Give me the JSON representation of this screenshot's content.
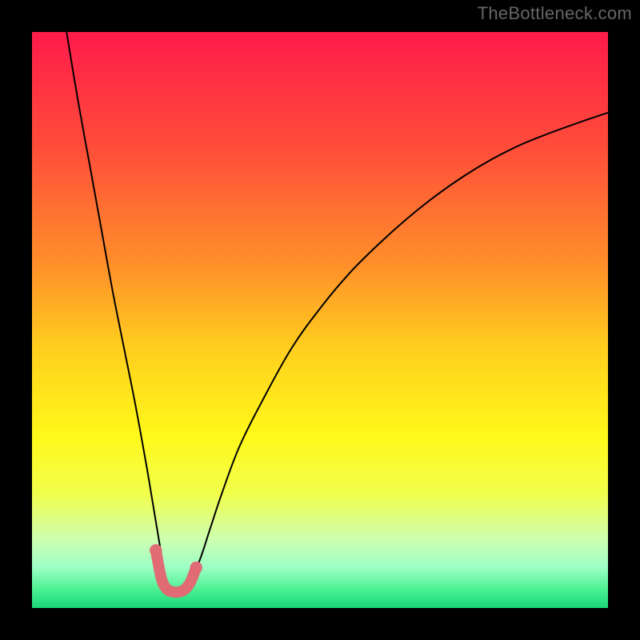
{
  "attribution": "TheBottleneck.com",
  "chart_data": {
    "type": "line",
    "title": "",
    "xlabel": "",
    "ylabel": "",
    "xlim": [
      0,
      100
    ],
    "ylim": [
      0,
      100
    ],
    "grid": false,
    "legend": false,
    "gradient_stops": [
      {
        "offset": 0.0,
        "color": "#ff1b4b"
      },
      {
        "offset": 0.2,
        "color": "#ff4d3a"
      },
      {
        "offset": 0.4,
        "color": "#ff8e2a"
      },
      {
        "offset": 0.55,
        "color": "#ffcf1e"
      },
      {
        "offset": 0.7,
        "color": "#fff81a"
      },
      {
        "offset": 0.8,
        "color": "#f1ff4a"
      },
      {
        "offset": 0.88,
        "color": "#cfffb0"
      },
      {
        "offset": 0.93,
        "color": "#9cffc6"
      },
      {
        "offset": 0.97,
        "color": "#46f08f"
      },
      {
        "offset": 1.0,
        "color": "#1bd67a"
      }
    ],
    "series": [
      {
        "name": "bottleneck-curve",
        "color": "#000000",
        "stroke_width": 2,
        "x": [
          6,
          8,
          10,
          12,
          14,
          16,
          18,
          20,
          22,
          23.5,
          25,
          27,
          29,
          31,
          33,
          36,
          40,
          45,
          50,
          55,
          60,
          65,
          70,
          75,
          80,
          85,
          90,
          95,
          100
        ],
        "values": [
          100,
          88,
          77,
          66,
          55,
          45,
          35,
          24,
          12,
          4,
          3,
          4,
          8,
          14,
          20,
          28,
          36,
          45,
          52,
          58,
          63,
          67.5,
          71.5,
          75,
          78,
          80.5,
          82.5,
          84.3,
          86
        ]
      },
      {
        "name": "valley-highlight",
        "color": "#e06b74",
        "stroke_width": 14,
        "linecap": "round",
        "x": [
          21.5,
          22.5,
          23.5,
          24.5,
          25.5,
          26.5,
          27.5,
          28.5
        ],
        "values": [
          10,
          5,
          3.2,
          2.8,
          2.8,
          3.2,
          4.5,
          7
        ]
      }
    ]
  }
}
